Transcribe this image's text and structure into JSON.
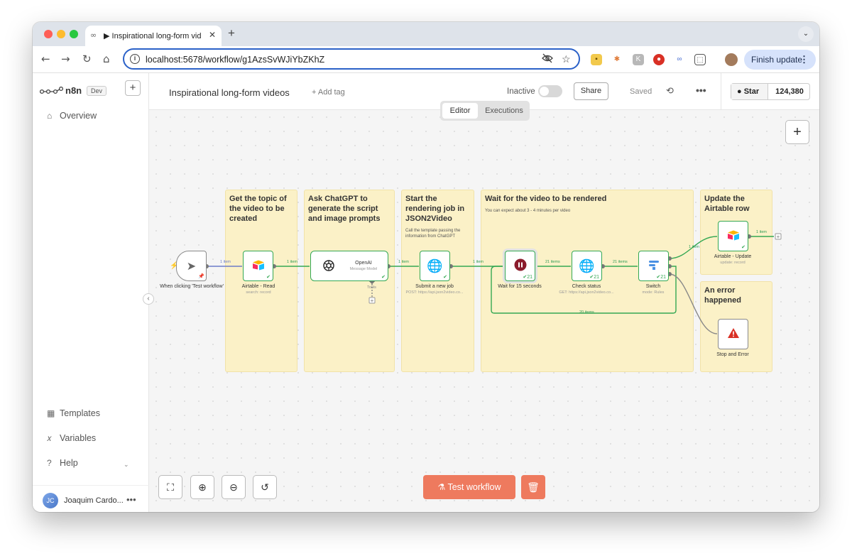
{
  "browser": {
    "tab_title": "▶ Inspirational long-form vide",
    "url": "localhost:5678/workflow/g1AzsSvWJiYbZKhZ",
    "finish_update": "Finish update"
  },
  "sidebar": {
    "logo": "n8n",
    "badge": "Dev",
    "items": [
      {
        "label": "Overview"
      },
      {
        "label": "Templates"
      },
      {
        "label": "Variables"
      },
      {
        "label": "Help"
      }
    ],
    "user": {
      "initials": "JC",
      "name": "Joaquim Cardo..."
    }
  },
  "header": {
    "workflow_title": "Inspirational long-form videos",
    "add_tag": "+ Add tag",
    "status_label": "Inactive",
    "share": "Share",
    "saved": "Saved",
    "github_star": "Star",
    "github_count": "124,380"
  },
  "view_tabs": {
    "editor": "Editor",
    "executions": "Executions"
  },
  "stickies": [
    {
      "title": "Get the topic of the video to be created",
      "text": ""
    },
    {
      "title": "Ask ChatGPT to generate the script and image prompts",
      "text": ""
    },
    {
      "title": "Start the rendering job in JSON2Video",
      "text": "Call the template passing the information from ChatGPT"
    },
    {
      "title": "Wait for the video to be rendered",
      "text": "You can expect about 3 - 4 minutes per video"
    },
    {
      "title": "Update the Airtable row",
      "text": ""
    },
    {
      "title": "An error happened",
      "text": ""
    }
  ],
  "nodes": {
    "trigger": {
      "label": "When clicking 'Test workflow'"
    },
    "airtable_read": {
      "label": "Airtable - Read",
      "sub": "search: record"
    },
    "openai": {
      "label": "OpenAI",
      "sub": "Message Model",
      "tools": "Tools"
    },
    "submit": {
      "label": "Submit a new job",
      "sub": "POST: https://api.json2video.co..."
    },
    "wait": {
      "label": "Wait for 15 seconds",
      "count": "21"
    },
    "check": {
      "label": "Check status",
      "sub": "GET: https://api.json2video.co...",
      "count": "21"
    },
    "switch": {
      "label": "Switch",
      "sub": "mode: Rules",
      "count": "21"
    },
    "airtable_update": {
      "label": "Airtable - Update",
      "sub": "update: record"
    },
    "stop": {
      "label": "Stop and Error"
    }
  },
  "edges": {
    "e1": "1 item",
    "e2": "1 item",
    "e3": "1 item",
    "e4": "1 item",
    "e5": "21 items",
    "e6": "21 items",
    "e7": "1 item",
    "e8": "1 item",
    "loop": "20 items"
  },
  "footer": {
    "test_workflow": "Test workflow"
  }
}
